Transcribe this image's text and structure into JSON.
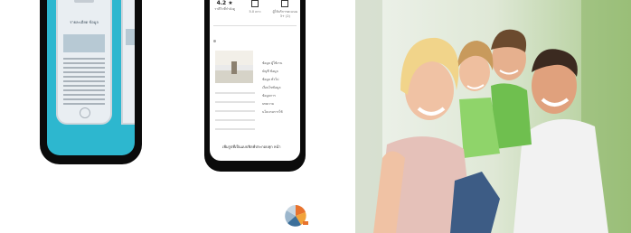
{
  "middle_phone": {
    "stats": [
      {
        "value": "4.2 ★",
        "label": "ราคีวิวที่กำลังดู"
      },
      {
        "value": "",
        "label": "5.0 ดาว"
      },
      {
        "value": "",
        "label": "ผู้ให้บริการคะแนน 3+ (2)"
      }
    ],
    "menu": [
      "ข้อมูล ผู้ใช้งาน",
      "บัญชี ข้อมูล",
      "ข้อมูล ทั่วไป",
      "เงื่อนไขข้อมูล",
      "ข้อมูลการ",
      "บทความ",
      "นโยบายการใช้"
    ],
    "caption": "เพิ่มรูปที่เป็นแบบฟิลฟ์ประกอบทุก หน้า"
  },
  "left_phone": {
    "title": "รายละเอียด ข้อมูล"
  },
  "colors": {
    "teal": "#2db7cf",
    "phone_frame": "#0b0b0b"
  }
}
